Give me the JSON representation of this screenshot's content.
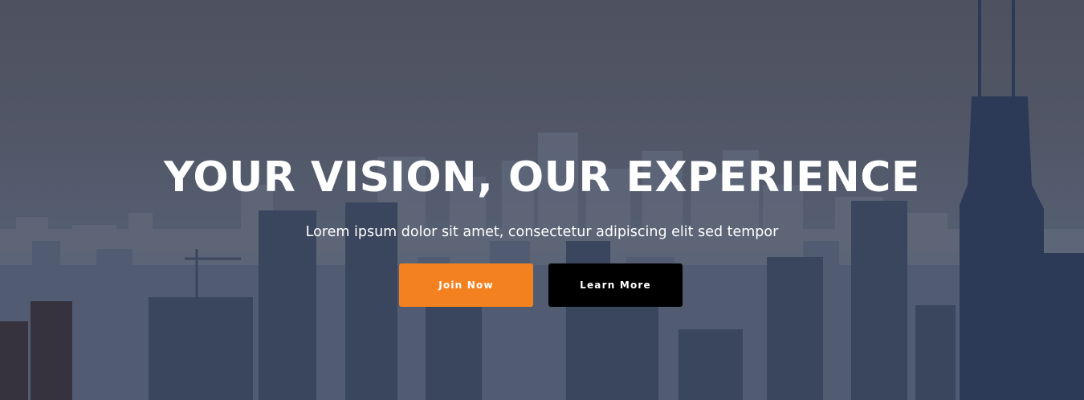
{
  "hero": {
    "title": "YOUR VISION, OUR EXPERIENCE",
    "subtitle": "Lorem ipsum dolor sit amet, consectetur adipiscing elit sed tempor",
    "primary_button": "Join Now",
    "secondary_button": "Learn More"
  },
  "colors": {
    "accent": "#f48120",
    "secondary_button_bg": "#000000",
    "text": "#ffffff"
  }
}
